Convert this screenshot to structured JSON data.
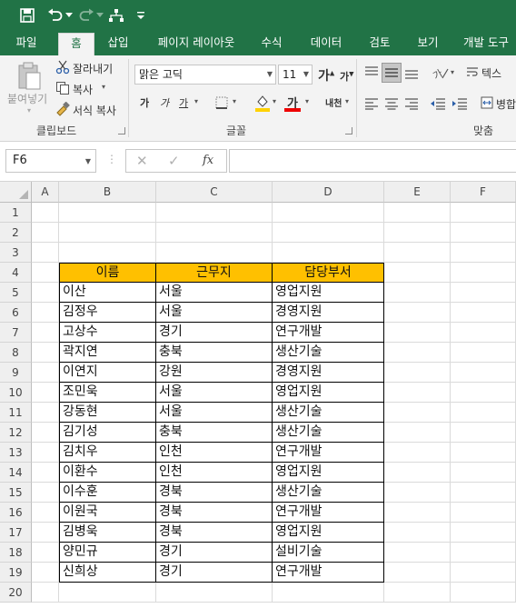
{
  "tabs": [
    "파일",
    "홈",
    "삽입",
    "페이지 레이아웃",
    "수식",
    "데이터",
    "검토",
    "보기",
    "개발 도구"
  ],
  "active_tab": "홈",
  "ribbon": {
    "clipboard": {
      "paste_label": "붙여넣기",
      "cut_label": "잘라내기",
      "copy_label": "복사",
      "format_painter_label": "서식 복사",
      "group_label": "클립보드"
    },
    "font": {
      "font_name": "맑은 고딕",
      "font_size": "11",
      "grow_label": "가",
      "shrink_label": "가",
      "bold_label": "가",
      "italic_label": "가",
      "underline_label": "가",
      "font_color_label": "가",
      "phonetic_label": "내천",
      "group_label": "글꼴"
    },
    "alignment": {
      "wrap_label": "텍스",
      "merge_label": "병합",
      "group_label": "맞춤"
    }
  },
  "name_box": "F6",
  "fx_label": "fx",
  "columns": [
    "A",
    "B",
    "C",
    "D",
    "E",
    "F"
  ],
  "rows": [
    "1",
    "2",
    "3",
    "4",
    "5",
    "6",
    "7",
    "8",
    "9",
    "10",
    "11",
    "12",
    "13",
    "14",
    "15",
    "16",
    "17",
    "18",
    "19",
    "20"
  ],
  "table": {
    "headers": [
      "이름",
      "근무지",
      "담당부서"
    ],
    "header_color": "#ffc000",
    "rows": [
      [
        "이산",
        "서울",
        "영업지원"
      ],
      [
        "김정우",
        "서울",
        "경영지원"
      ],
      [
        "고상수",
        "경기",
        "연구개발"
      ],
      [
        "곽지연",
        "충북",
        "생산기술"
      ],
      [
        "이연지",
        "강원",
        "경영지원"
      ],
      [
        "조민욱",
        "서울",
        "영업지원"
      ],
      [
        "강동현",
        "서울",
        "생산기술"
      ],
      [
        "김기성",
        "충북",
        "생산기술"
      ],
      [
        "김치우",
        "인천",
        "연구개발"
      ],
      [
        "이환수",
        "인천",
        "영업지원"
      ],
      [
        "이수훈",
        "경북",
        "생산기술"
      ],
      [
        "이원국",
        "경북",
        "연구개발"
      ],
      [
        "김병욱",
        "경북",
        "영업지원"
      ],
      [
        "양민규",
        "경기",
        "설비기술"
      ],
      [
        "신희상",
        "경기",
        "연구개발"
      ]
    ]
  },
  "colors": {
    "excel_green": "#217346",
    "ribbon_bg": "#f3f3f3"
  }
}
